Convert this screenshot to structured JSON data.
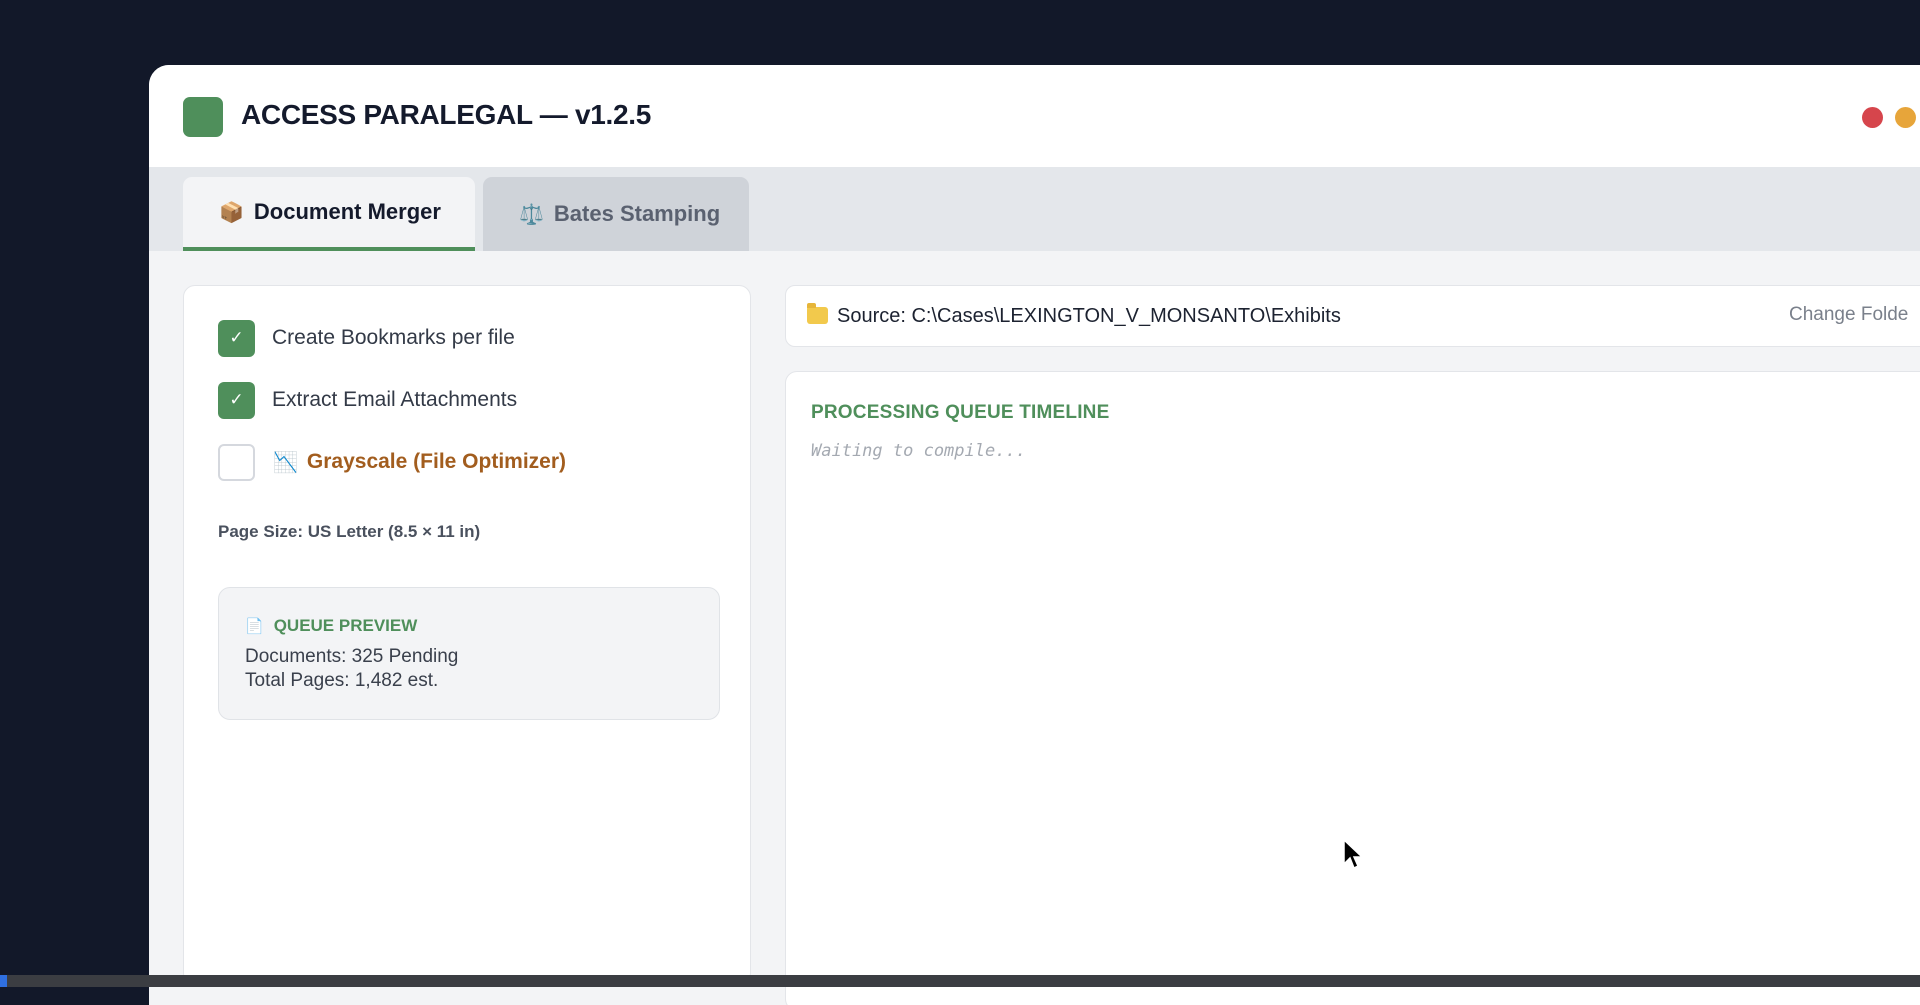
{
  "window": {
    "title": "ACCESS PARALEGAL — v1.2.5",
    "accent_color": "#4f8f5b",
    "controls": {
      "close_color": "#d6454c",
      "minimize_color": "#e7a53a"
    }
  },
  "tabs": [
    {
      "label": "Document Merger",
      "icon": "package-icon",
      "glyph": "📦",
      "active": true
    },
    {
      "label": "Bates Stamping",
      "icon": "scales-icon",
      "glyph": "⚖️",
      "active": false
    }
  ],
  "options": [
    {
      "label": "Create Bookmarks per file",
      "checked": true
    },
    {
      "label": "Extract Email Attachments",
      "checked": true
    },
    {
      "label": "Grayscale (File Optimizer)",
      "checked": false,
      "icon": "chart-decreasing-icon",
      "glyph": "📉"
    }
  ],
  "page_size": "Page Size: US Letter (8.5 × 11 in)",
  "queue_preview": {
    "title": "QUEUE PREVIEW",
    "icon": "document-icon",
    "glyph": "📄",
    "documents": "Documents: 325 Pending",
    "pages": "Total Pages: 1,482 est."
  },
  "source": {
    "icon": "folder-icon",
    "text": "Source: C:\\Cases\\LEXINGTON_V_MONSANTO\\Exhibits",
    "change_label": "Change Folde"
  },
  "timeline": {
    "title": "PROCESSING QUEUE TIMELINE",
    "status": "Waiting to compile..."
  }
}
